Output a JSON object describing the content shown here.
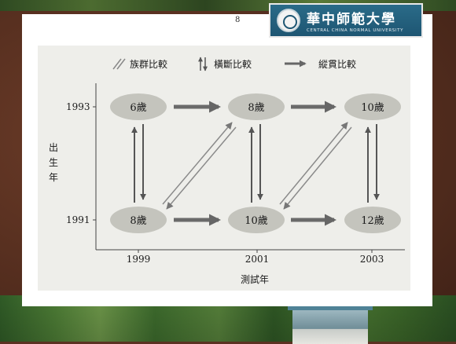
{
  "slide": {
    "page_number": "8",
    "logo": {
      "name_cn": "華中師範大學",
      "name_en": "CENTRAL CHINA NORMAL UNIVERSITY",
      "seal_icon": "university-seal-icon"
    }
  },
  "diagram": {
    "legend": [
      {
        "icon": "double-diagonal-lines-icon",
        "label": "族群比較"
      },
      {
        "icon": "up-down-arrows-icon",
        "label": "橫斷比較"
      },
      {
        "icon": "right-arrow-icon",
        "label": "縱貫比較"
      }
    ],
    "y_axis_label": "出生年",
    "x_axis_label": "測試年",
    "y_ticks": [
      "1993",
      "1991"
    ],
    "x_ticks": [
      "1999",
      "2001",
      "2003"
    ],
    "nodes_1993": [
      "6歲",
      "8歲",
      "10歲"
    ],
    "nodes_1991": [
      "8歲",
      "10歲",
      "12歲"
    ]
  },
  "colors": {
    "node_fill": "#c4c4bd",
    "arrow": "#555555",
    "frame": "#5b3222",
    "logo_bg": "#1e5673"
  }
}
